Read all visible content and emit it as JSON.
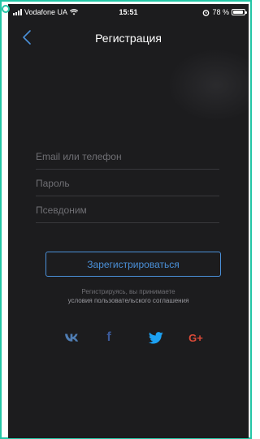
{
  "status_bar": {
    "carrier": "Vodafone UA",
    "time": "15:51",
    "battery": "78 %"
  },
  "nav": {
    "title": "Регистрация",
    "back_icon": "chevron-left-icon"
  },
  "form": {
    "email_placeholder": "Email или телефон",
    "password_placeholder": "Пароль",
    "nickname_placeholder": "Псевдоним",
    "register_label": "Зарегистрироваться"
  },
  "terms": {
    "line1": "Регистрируясь, вы принимаете",
    "line2": "условия пользовательского соглашения"
  },
  "social": {
    "vk": "VK",
    "facebook": "f",
    "google_plus": "G+"
  },
  "colors": {
    "background": "#1c1c1e",
    "accent": "#4a90d9",
    "frame": "#23c6a6",
    "vk": "#4f7db3",
    "facebook": "#3b5998",
    "twitter": "#1da1f2",
    "google_plus": "#dd4b39"
  }
}
